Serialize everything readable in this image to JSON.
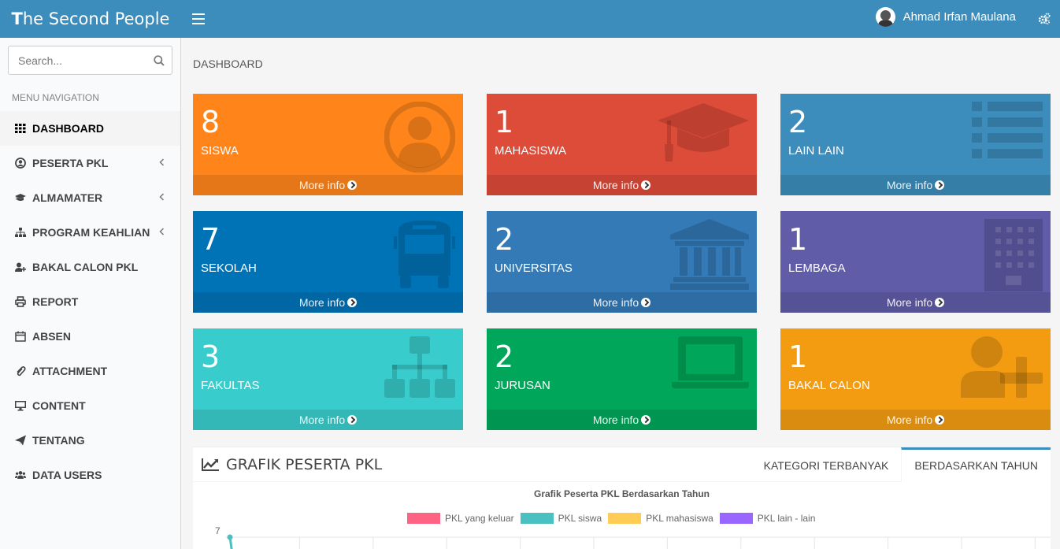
{
  "app": {
    "logo_first": "T",
    "logo_rest": "he Second People"
  },
  "user": {
    "name": "Ahmad Irfan Maulana"
  },
  "sidebar": {
    "search_placeholder": "Search...",
    "header": "MENU NAVIGATION",
    "items": [
      {
        "label": "DASHBOARD",
        "icon": "grid-icon",
        "active": true
      },
      {
        "label": "PESERTA PKL",
        "icon": "user-circle-icon",
        "chevron": true
      },
      {
        "label": "ALMAMATER",
        "icon": "graduation-cap-icon",
        "chevron": true
      },
      {
        "label": "PROGRAM KEAHLIAN",
        "icon": "sitemap-icon",
        "chevron": true
      },
      {
        "label": "BAKAL CALON PKL",
        "icon": "user-plus-icon"
      },
      {
        "label": "REPORT",
        "icon": "print-icon"
      },
      {
        "label": "ABSEN",
        "icon": "calendar-icon"
      },
      {
        "label": "ATTACHMENT",
        "icon": "paperclip-icon"
      },
      {
        "label": "CONTENT",
        "icon": "desktop-icon"
      },
      {
        "label": "TENTANG",
        "icon": "paper-plane-icon"
      },
      {
        "label": "DATA USERS",
        "icon": "users-icon"
      }
    ]
  },
  "main": {
    "page_title": "DASHBOARD",
    "boxes": [
      {
        "value": "8",
        "label": "SISWA",
        "icon": "user-circle-icon",
        "color": "#ff851b",
        "more": "More info"
      },
      {
        "value": "1",
        "label": "MAHASISWA",
        "icon": "graduation-cap-icon",
        "color": "#dd4b39",
        "more": "More info"
      },
      {
        "value": "2",
        "label": "LAIN LAIN",
        "icon": "list-icon",
        "color": "#3c8dbc",
        "more": "More info"
      },
      {
        "value": "7",
        "label": "SEKOLAH",
        "icon": "bus-icon",
        "color": "#0073b7",
        "more": "More info"
      },
      {
        "value": "2",
        "label": "UNIVERSITAS",
        "icon": "university-icon",
        "color": "#337ab7",
        "more": "More info"
      },
      {
        "value": "1",
        "label": "LEMBAGA",
        "icon": "building-icon",
        "color": "#605ca8",
        "more": "More info"
      },
      {
        "value": "3",
        "label": "FAKULTAS",
        "icon": "sitemap-icon",
        "color": "#39cccc",
        "more": "More info"
      },
      {
        "value": "2",
        "label": "JURUSAN",
        "icon": "laptop-icon",
        "color": "#00a65a",
        "more": "More info"
      },
      {
        "value": "1",
        "label": "BAKAL CALON",
        "icon": "user-plus-icon",
        "color": "#f39c12",
        "more": "More info"
      }
    ],
    "chart_panel": {
      "title": "GRAFIK PESERTA PKL",
      "tabs": [
        {
          "label": "KATEGORI TERBANYAK",
          "active": false
        },
        {
          "label": "BERDASARKAN TAHUN",
          "active": true
        }
      ]
    }
  },
  "chart_data": {
    "type": "line",
    "title": "Grafik Peserta PKL Berdasarkan Tahun",
    "series": [
      {
        "name": "PKL yang keluar",
        "color": "#ff6384",
        "values": []
      },
      {
        "name": "PKL siswa",
        "color": "#4bc0c0",
        "values": [
          7
        ]
      },
      {
        "name": "PKL mahasiswa",
        "color": "#ffcd56",
        "values": []
      },
      {
        "name": "PKL lain - lain",
        "color": "#9966ff",
        "values": []
      }
    ],
    "y_ticks_visible": [
      "7"
    ],
    "ylim_top": 7
  }
}
